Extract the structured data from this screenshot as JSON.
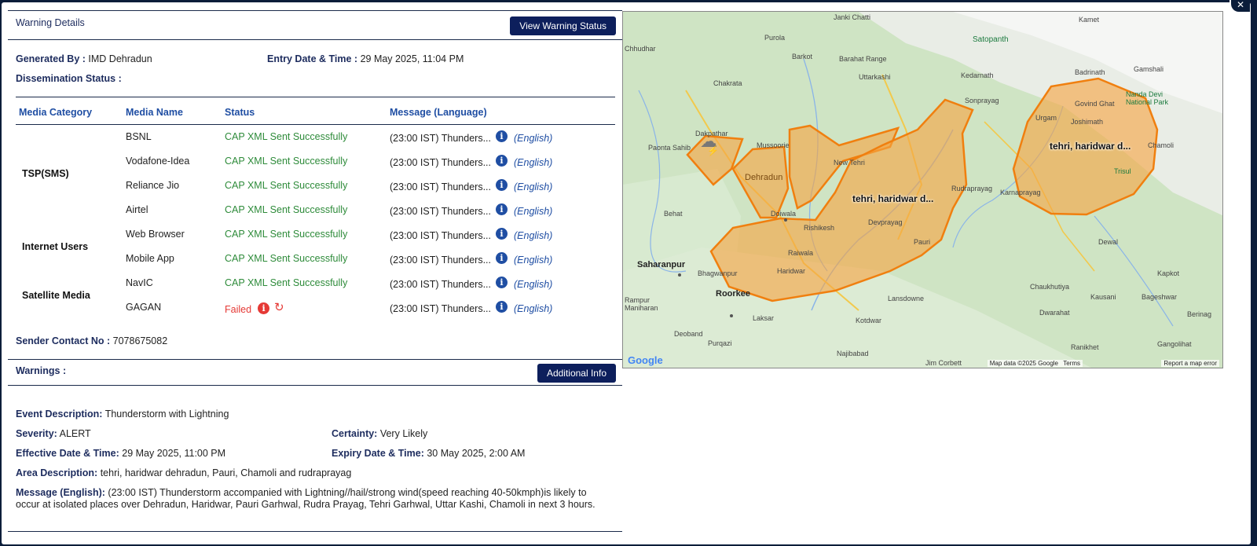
{
  "warning_details": {
    "title": "Warning Details",
    "view_status_btn": "View Warning Status",
    "generated_by_label": "Generated By :",
    "generated_by": "IMD Dehradun",
    "entry_label": "Entry Date & Time :",
    "entry_value": "29 May 2025, 11:04 PM",
    "dissemination_label": "Dissemination Status :"
  },
  "table": {
    "headers": [
      "Media Category",
      "Media Name",
      "Status",
      "Message (Language)"
    ],
    "categories": [
      "TSP(SMS)",
      "Internet Users",
      "Satellite Media"
    ],
    "rows": [
      {
        "name": "BSNL",
        "status": "CAP XML Sent Successfully",
        "message": "(23:00 IST) Thunders...",
        "lang": "(English)"
      },
      {
        "name": "Vodafone-Idea",
        "status": "CAP XML Sent Successfully",
        "message": "(23:00 IST) Thunders...",
        "lang": "(English)"
      },
      {
        "name": "Reliance Jio",
        "status": "CAP XML Sent Successfully",
        "message": "(23:00 IST) Thunders...",
        "lang": "(English)"
      },
      {
        "name": "Airtel",
        "status": "CAP XML Sent Successfully",
        "message": "(23:00 IST) Thunders...",
        "lang": "(English)"
      },
      {
        "name": "Web Browser",
        "status": "CAP XML Sent Successfully",
        "message": "(23:00 IST) Thunders...",
        "lang": "(English)"
      },
      {
        "name": "Mobile App",
        "status": "CAP XML Sent Successfully",
        "message": "(23:00 IST) Thunders...",
        "lang": "(English)"
      },
      {
        "name": "NavIC",
        "status": "CAP XML Sent Successfully",
        "message": "(23:00 IST) Thunders...",
        "lang": "(English)"
      },
      {
        "name": "GAGAN",
        "status": "Failed",
        "message": "(23:00 IST) Thunders...",
        "lang": "(English)"
      }
    ]
  },
  "sender": {
    "label": "Sender Contact No :",
    "value": "7078675082"
  },
  "warnings": {
    "title": "Warnings :",
    "additional_btn": "Additional Info",
    "event_label": "Event Description:",
    "event_value": "Thunderstorm with Lightning",
    "severity_label": "Severity:",
    "severity_value": "ALERT",
    "certainty_label": "Certainty:",
    "certainty_value": "Very Likely",
    "effective_label": "Effective Date & Time:",
    "effective_value": "29 May 2025, 11:00 PM",
    "expiry_label": "Expiry Date & Time:",
    "expiry_value": "30 May 2025, 2:00 AM",
    "area_label": "Area Description:",
    "area_value": "tehri, haridwar dehradun, Pauri, Chamoli and rudraprayag",
    "message_label": "Message (English):",
    "message_value": "(23:00 IST) Thunderstorm accompanied with Lightning//hail/strong wind(speed reaching 40-50kmph)is likely to occur at isolated places over Dehradun, Haridwar, Pauri Garhwal, Rudra Prayag, Tehri Garhwal, Uttar Kashi, Chamoli in next 3 hours."
  },
  "map": {
    "area_label": "tehri, haridwar d...",
    "places": [
      "Janki Chatti",
      "Kamet",
      "Satopanth",
      "Purola",
      "Barkot",
      "Barahat Range",
      "Chhudhar",
      "Uttarkashi",
      "Chakrata",
      "Kedarnath",
      "Badrinath",
      "Gamshali",
      "Nanda Devi National Park",
      "Sonprayag",
      "Govind Ghat",
      "Urgam",
      "Joshimath",
      "Dakpathar",
      "Paonta Sahib",
      "Mussoorie",
      "New Tehri",
      "Dehradun",
      "Rudraprayag",
      "Chamoli",
      "Trisul",
      "Karnaprayag",
      "Behat",
      "Doiwala",
      "Rishikesh",
      "Devprayag",
      "Pauri",
      "Raiwala",
      "Dewal",
      "Saharanpur",
      "Bhagwanpur",
      "Haridwar",
      "Kapkot",
      "Roorkee",
      "Chaukhutiya",
      "Rampur Maniharan",
      "Lansdowne",
      "Kausani",
      "Bageshwar",
      "Dwarahat",
      "Laksar",
      "Kotdwar",
      "Berinag",
      "Deoband",
      "Purqazi",
      "Ranikhet",
      "Gangolihat",
      "Najibabad",
      "Jim Corbett"
    ],
    "footer": [
      "Map data ©2025 Google",
      "Terms",
      "Report a map error"
    ],
    "logo": "Google"
  }
}
